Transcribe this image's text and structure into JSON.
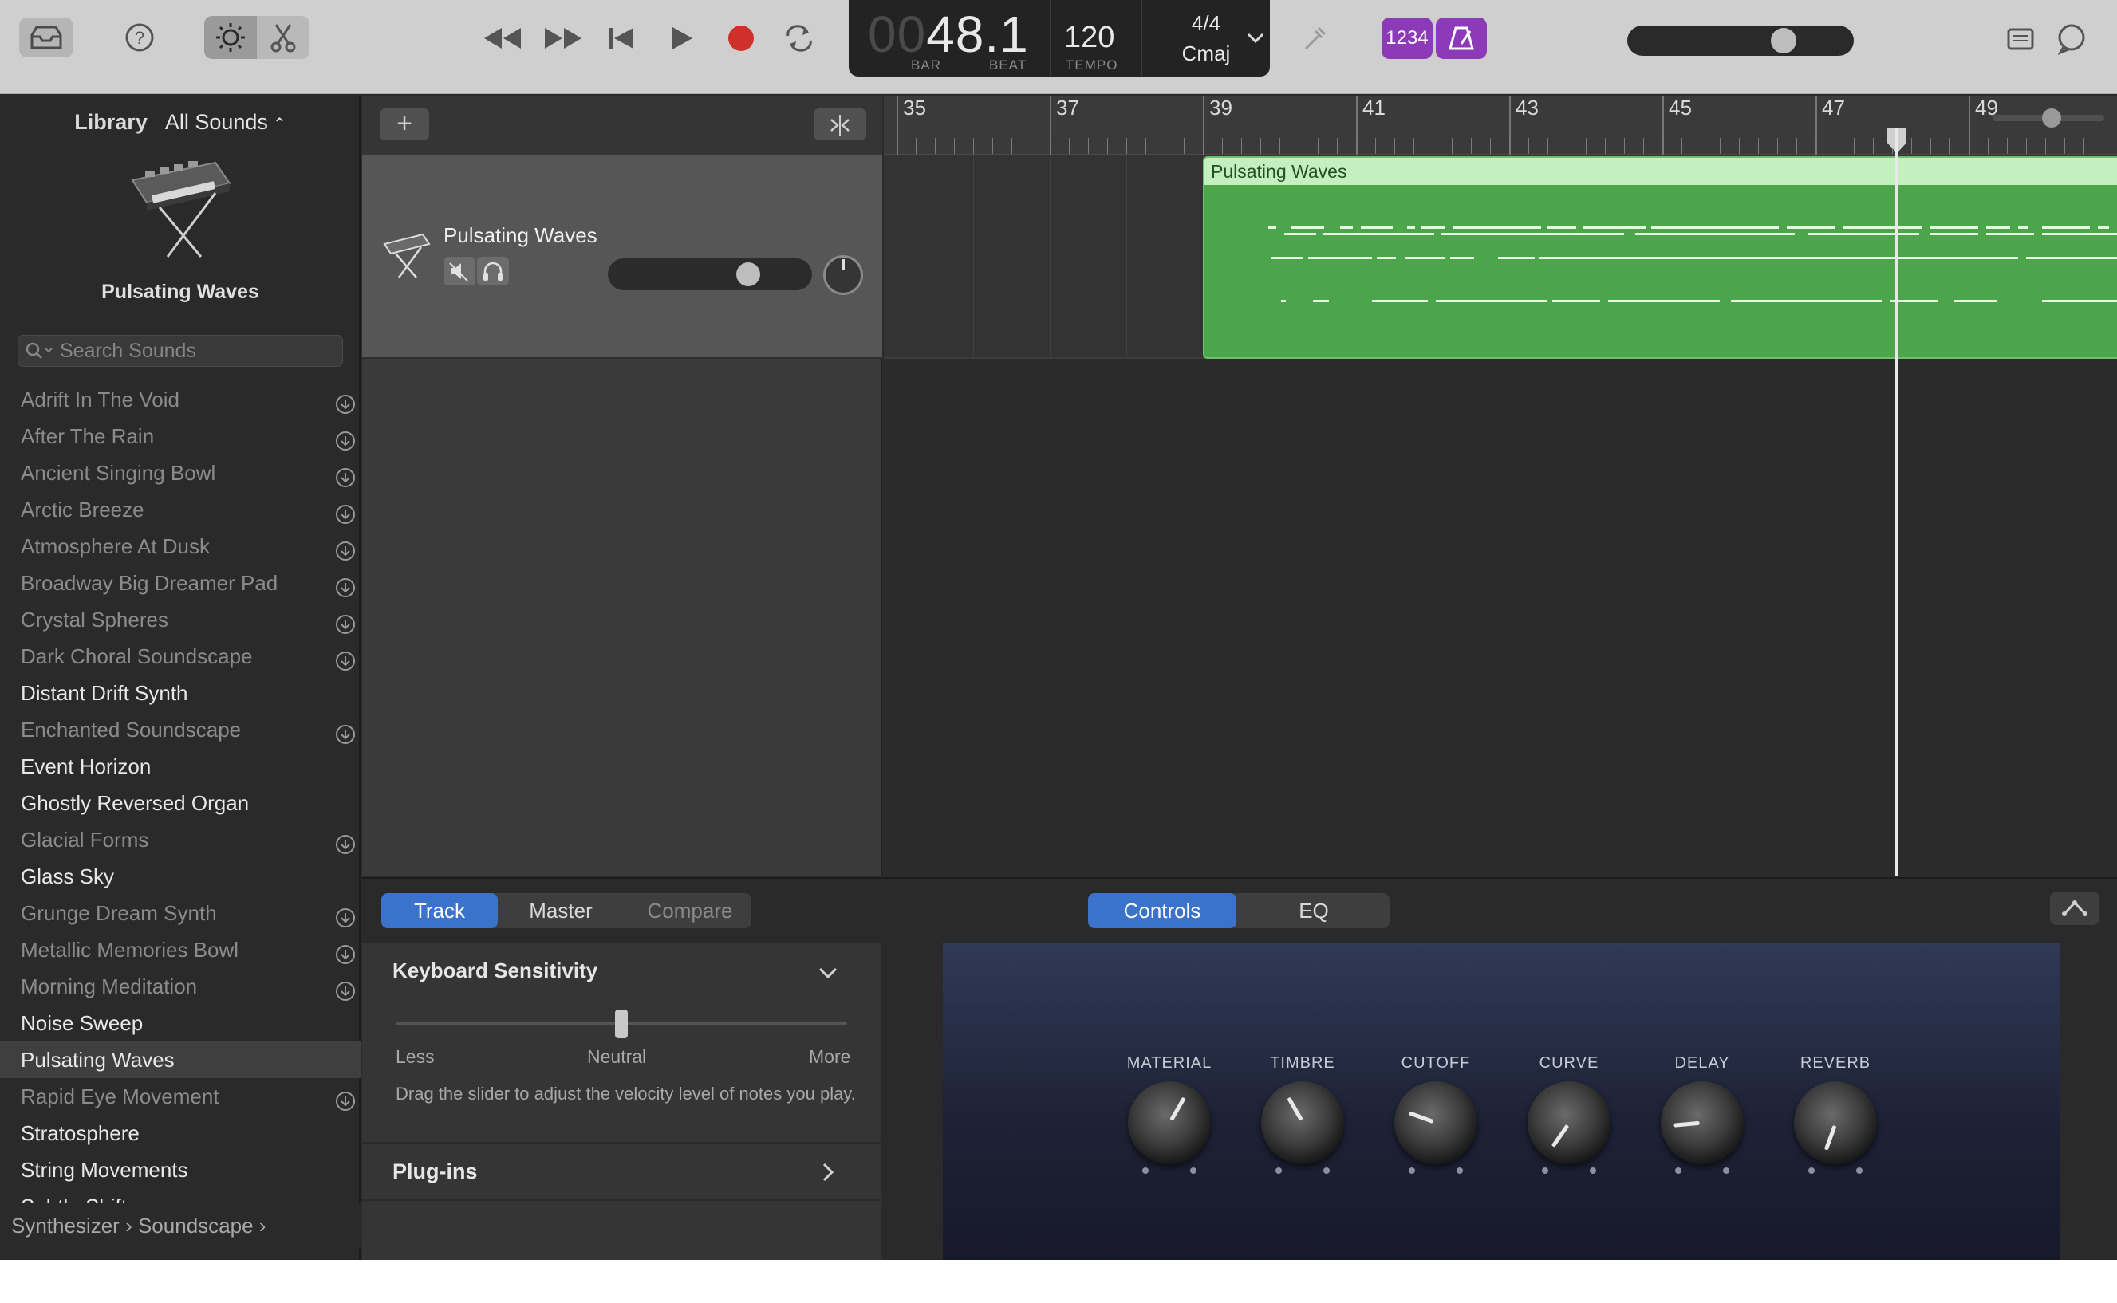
{
  "toolbar": {
    "lcd": {
      "position_dim": "00",
      "position": "48.1",
      "bar_label": "BAR",
      "beat_label": "BEAT",
      "tempo": "120",
      "tempo_label": "TEMPO",
      "signature": "4/4",
      "key": "Cmaj"
    },
    "count_in_label": "1234",
    "master_volume_level": 0.72
  },
  "library": {
    "header_label": "Library",
    "filter_label": "All Sounds",
    "selected_title": "Pulsating Waves",
    "search_placeholder": "Search Sounds",
    "items": [
      {
        "label": "Adrift In The Void",
        "downloadable": true
      },
      {
        "label": "After The Rain",
        "downloadable": true
      },
      {
        "label": "Ancient Singing Bowl",
        "downloadable": true
      },
      {
        "label": "Arctic Breeze",
        "downloadable": true
      },
      {
        "label": "Atmosphere At Dusk",
        "downloadable": true
      },
      {
        "label": "Broadway Big Dreamer Pad",
        "downloadable": true
      },
      {
        "label": "Crystal Spheres",
        "downloadable": true
      },
      {
        "label": "Dark Choral Soundscape",
        "downloadable": true
      },
      {
        "label": "Distant Drift Synth",
        "downloadable": false
      },
      {
        "label": "Enchanted Soundscape",
        "downloadable": true
      },
      {
        "label": "Event Horizon",
        "downloadable": false
      },
      {
        "label": "Ghostly Reversed Organ",
        "downloadable": false
      },
      {
        "label": "Glacial Forms",
        "downloadable": true
      },
      {
        "label": "Glass Sky",
        "downloadable": false
      },
      {
        "label": "Grunge Dream Synth",
        "downloadable": true
      },
      {
        "label": "Metallic Memories Bowl",
        "downloadable": true
      },
      {
        "label": "Morning Meditation",
        "downloadable": true
      },
      {
        "label": "Noise Sweep",
        "downloadable": false
      },
      {
        "label": "Pulsating Waves",
        "downloadable": false,
        "selected": true
      },
      {
        "label": "Rapid Eye Movement",
        "downloadable": true
      },
      {
        "label": "Stratosphere",
        "downloadable": false
      },
      {
        "label": "String Movements",
        "downloadable": false
      },
      {
        "label": "Subtle Shiftscape",
        "downloadable": false
      }
    ],
    "breadcrumb": [
      "Synthesizer",
      "Soundscape"
    ]
  },
  "tracks": [
    {
      "name": "Pulsating Waves",
      "volume_level": 0.72,
      "pan": 0
    }
  ],
  "ruler": {
    "bars": [
      "35",
      "37",
      "39",
      "41",
      "43",
      "45",
      "47",
      "49"
    ]
  },
  "region": {
    "name": "Pulsating Waves"
  },
  "bottom": {
    "left_tabs": [
      "Track",
      "Master",
      "Compare"
    ],
    "active_left_tab": "Track",
    "right_tabs": [
      "Controls",
      "EQ"
    ],
    "active_right_tab": "Controls",
    "keyboard_sensitivity": {
      "title": "Keyboard Sensitivity",
      "value": 0.5,
      "less": "Less",
      "neutral": "Neutral",
      "more": "More",
      "help": "Drag the slider to adjust the velocity level of notes you play."
    },
    "plugins_label": "Plug-ins",
    "knobs": [
      {
        "label": "MATERIAL",
        "angle": 30
      },
      {
        "label": "TIMBRE",
        "angle": -30
      },
      {
        "label": "CUTOFF",
        "angle": -70
      },
      {
        "label": "CURVE",
        "angle": -145
      },
      {
        "label": "DELAY",
        "angle": -95
      },
      {
        "label": "REVERB",
        "angle": -160
      }
    ]
  },
  "colors": {
    "accent_blue": "#3a73c9",
    "record_red": "#d0302a",
    "region_green": "#4ca54a",
    "region_header": "#c4f0c0",
    "purple": "#8c3ab8"
  }
}
